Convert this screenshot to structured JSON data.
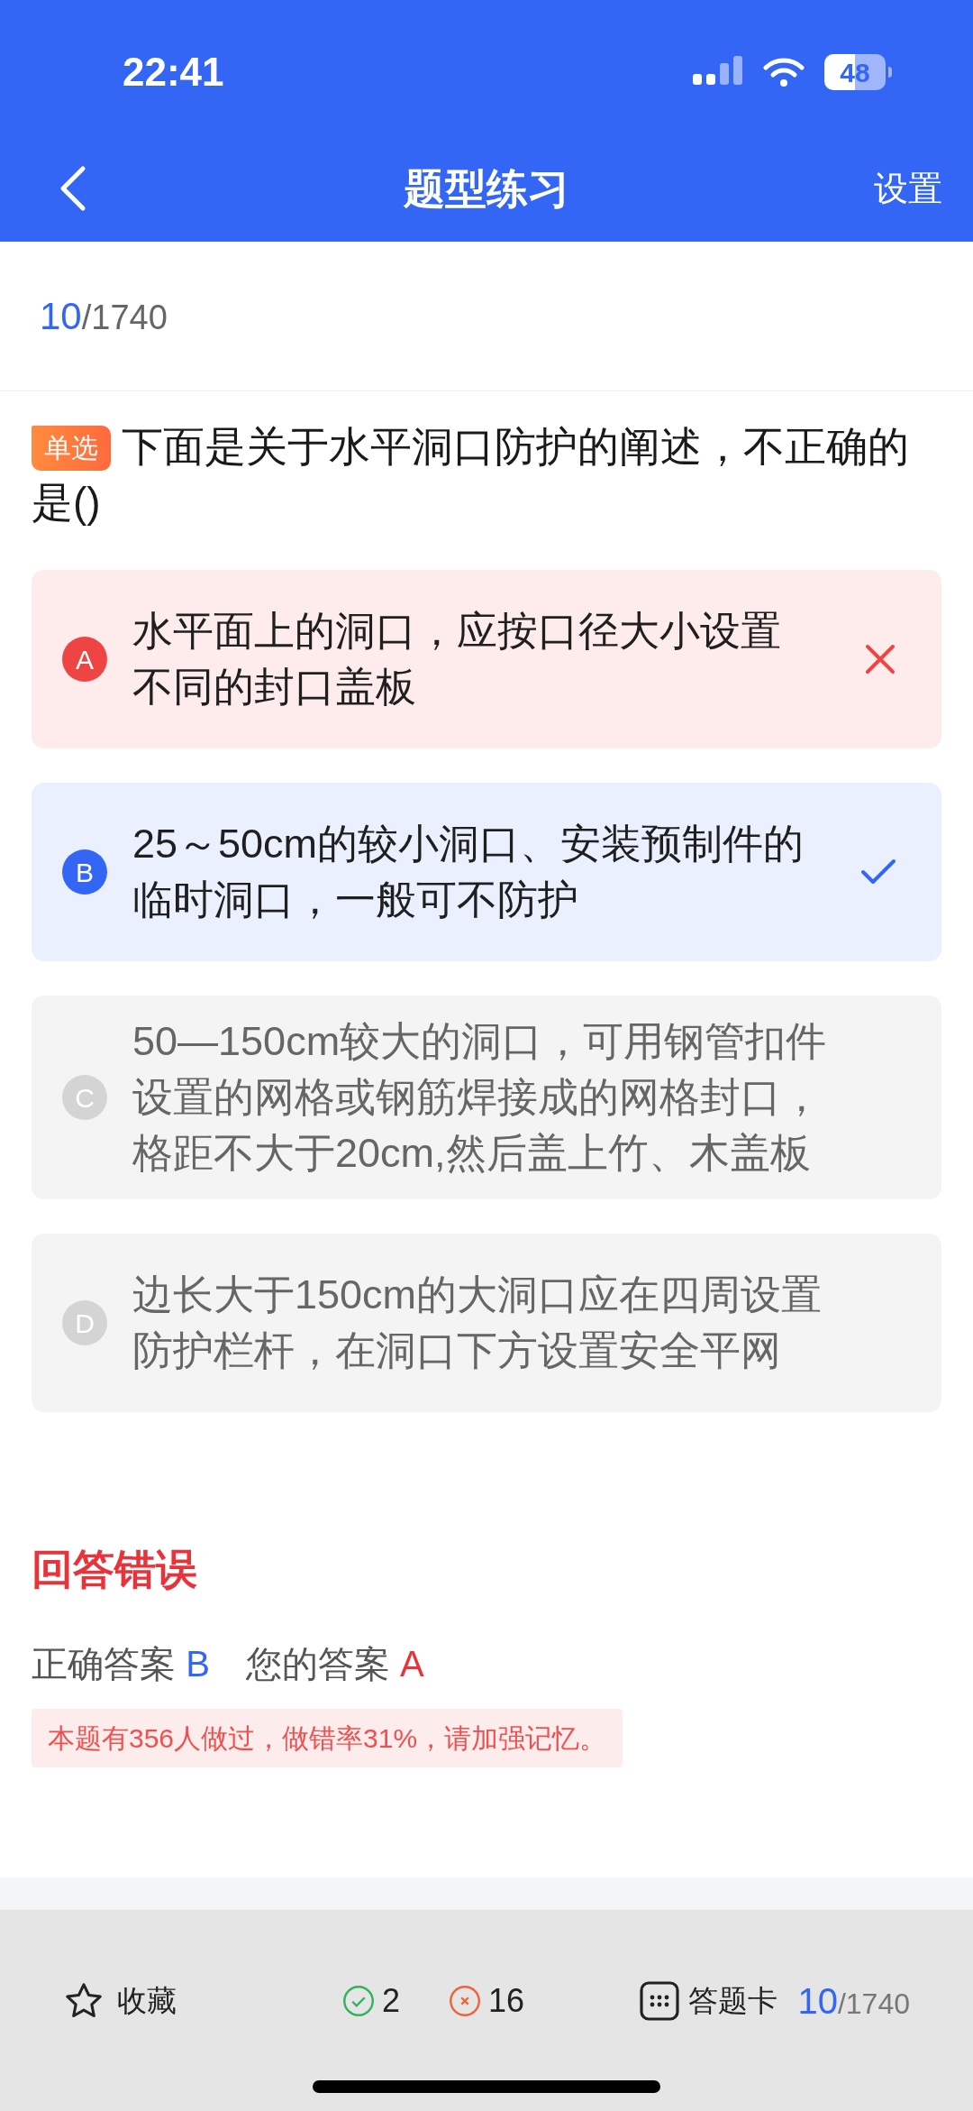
{
  "status_bar": {
    "time": "22:41",
    "battery": "48"
  },
  "nav": {
    "title": "题型练习",
    "action": "设置"
  },
  "progress": {
    "current": "10",
    "total": "/1740"
  },
  "question": {
    "type": "单选",
    "text": "下面是关于水平洞口防护的阐述，不正确的是()"
  },
  "options": [
    {
      "letter": "A",
      "text": "水平面上的洞口，应按口径大小设置不同的封口盖板",
      "kind": "wrong"
    },
    {
      "letter": "B",
      "text": "25～50cm的较小洞口、安装预制件的临时洞口，一般可不防护",
      "kind": "correct"
    },
    {
      "letter": "C",
      "text": "50—150cm较大的洞口，可用钢管扣件设置的网格或钢筋焊接成的网格封口，格距不大于20cm,然后盖上竹、木盖板",
      "kind": "plain"
    },
    {
      "letter": "D",
      "text": "边长大于150cm的大洞口应在四周设置防护栏杆，在洞口下方设置安全平网",
      "kind": "plain"
    }
  ],
  "result": {
    "title": "回答错误",
    "correct_label": "正确答案",
    "correct_answer": "B",
    "your_label": "您的答案",
    "your_answer": "A",
    "note": "本题有356人做过，做错率31%，请加强记忆。"
  },
  "bottom_bar": {
    "favorite": "收藏",
    "right_count": "2",
    "wrong_count": "16",
    "answer_card": "答题卡",
    "current": "10",
    "total": "/1740"
  }
}
